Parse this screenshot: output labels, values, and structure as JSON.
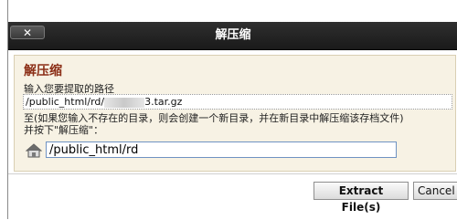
{
  "dialog": {
    "title": "解压缩",
    "close_label": "✕"
  },
  "form": {
    "heading": "解压缩",
    "path_label": "输入您要提取的路径",
    "path_prefix": "/public_html/rd/",
    "path_suffix": "3.tar.gz",
    "description_line1": "至(如果您输入不存在的目录，则会创建一个新目录，并在新目录中解压缩该存档文件)",
    "description_line2": "并按下\"解压缩\"：",
    "target_value": "/public_html/rd"
  },
  "buttons": {
    "extract_label": "Extract File(s)",
    "cancel_label": "Cancel"
  }
}
